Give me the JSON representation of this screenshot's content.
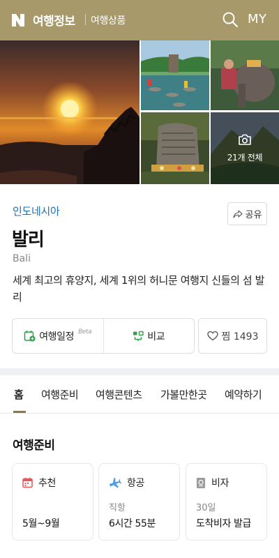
{
  "header": {
    "brand": "여행정보",
    "sub_brand": "여행상품",
    "my_label": "MY",
    "bg_color": "#a8996a",
    "icons": [
      "naver-n-icon",
      "search-icon"
    ]
  },
  "gallery": {
    "photo_count_label": "21개 전체",
    "icons": [
      "camera-icon"
    ]
  },
  "destination": {
    "country": "인도네시아",
    "name": "발리",
    "name_en": "Bali",
    "description": "세계 최고의 휴양지, 세계 1위의 허니문 여행지 신들의 섬 발리",
    "share_label": "공유",
    "accent_color": "#1b6fb8"
  },
  "actions": {
    "itinerary_label": "여행일정",
    "beta_label": "Beta",
    "compare_label": "비교",
    "like_label": "찜 1493"
  },
  "tabs": [
    {
      "label": "홈",
      "active": true
    },
    {
      "label": "여행준비",
      "active": false
    },
    {
      "label": "여행콘텐츠",
      "active": false
    },
    {
      "label": "가볼만한곳",
      "active": false
    },
    {
      "label": "예약하기",
      "active": false
    }
  ],
  "prep": {
    "title": "여행준비",
    "cards": [
      {
        "label": "추천",
        "sub": "",
        "value": "5월~9월",
        "icon": "calendar-icon"
      },
      {
        "label": "항공",
        "sub": "직항",
        "value": "6시간 55분",
        "icon": "airplane-icon"
      },
      {
        "label": "비자",
        "sub": "30일",
        "value": "도착비자 발급",
        "icon": "passport-icon"
      }
    ]
  }
}
